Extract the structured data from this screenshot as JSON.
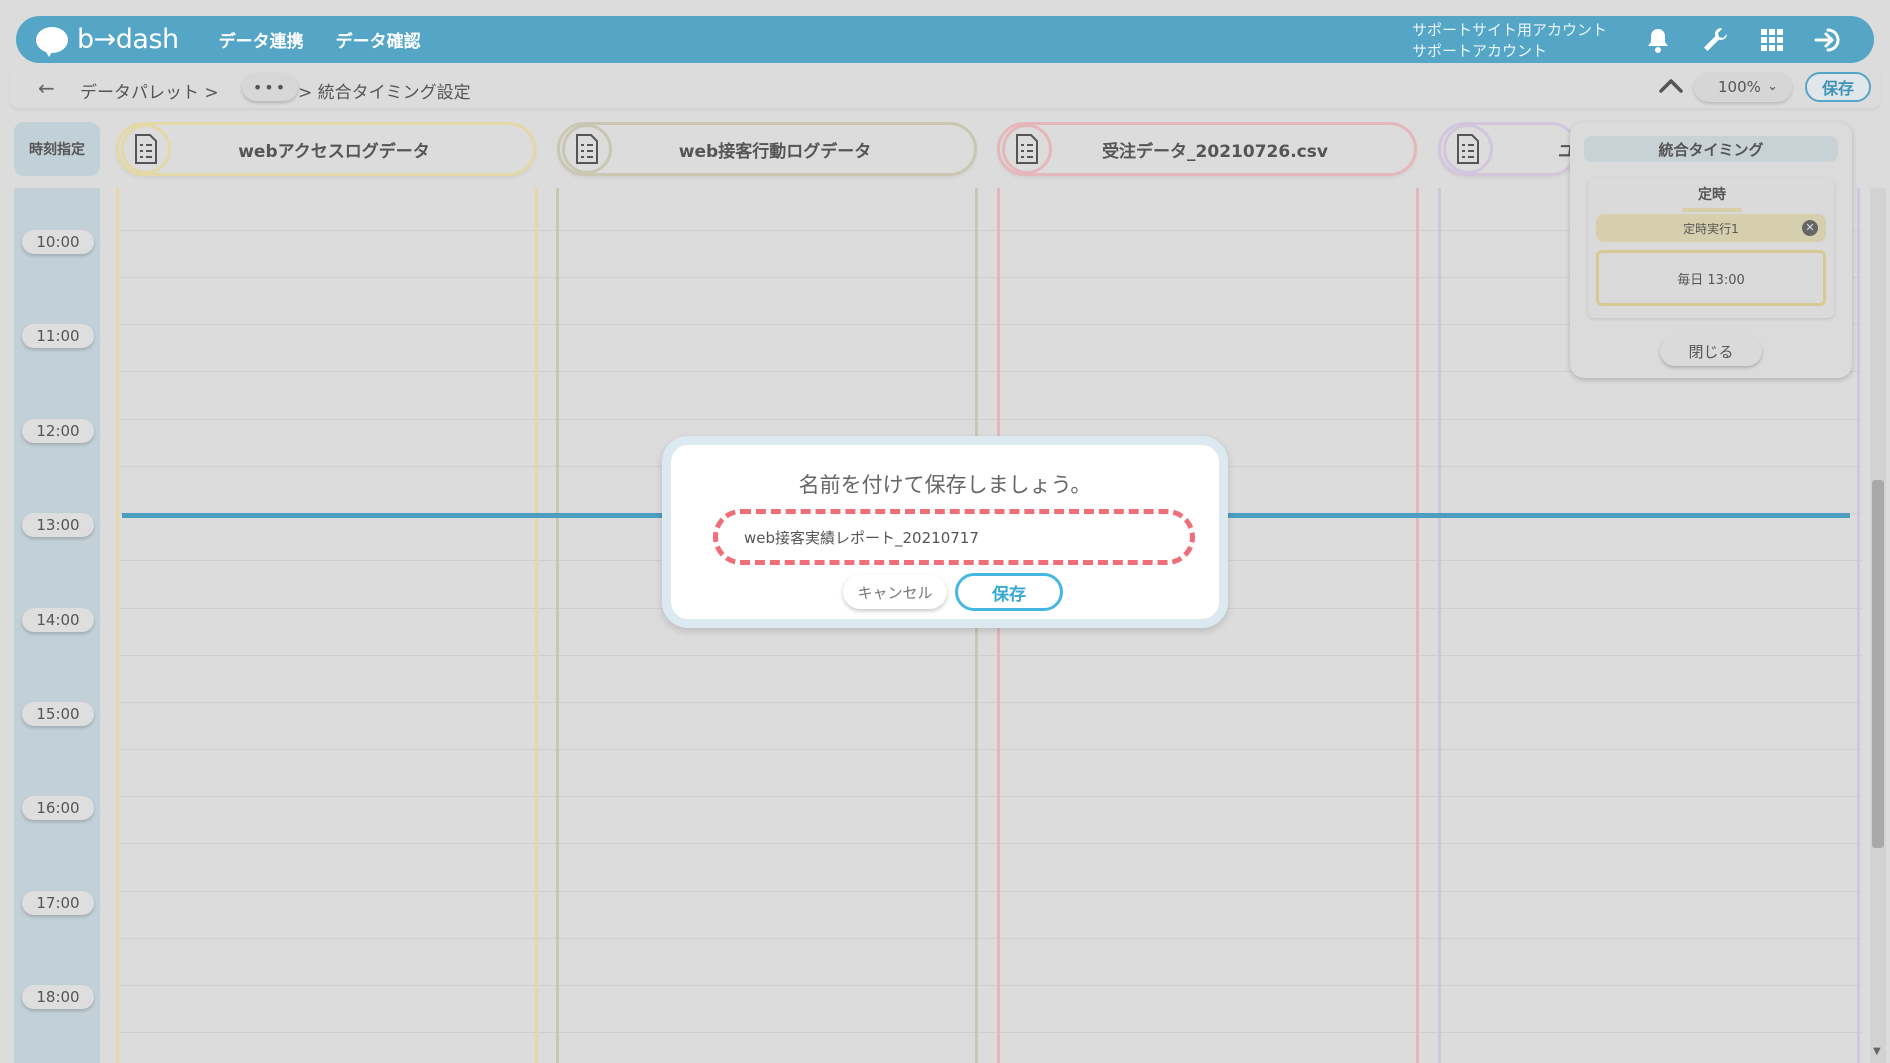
{
  "header": {
    "logo_text": "b→dash",
    "nav": [
      "データ連携",
      "データ確認"
    ],
    "account_line1": "サポートサイト用アカウント",
    "account_line2": "サポートアカウント",
    "icons": [
      "bell-icon",
      "wrench-icon",
      "apps-grid-icon",
      "logout-icon"
    ],
    "bar_color": "#55a6c6"
  },
  "toolbar": {
    "back_arrow": "←",
    "crumb_1": "データパレット >",
    "crumb_more": "•••",
    "crumb_3": "> 統合タイミング設定",
    "zoom": "100%",
    "save_label": "保存"
  },
  "timeline": {
    "time_header": "時刻指定",
    "times": [
      "10:00",
      "11:00",
      "12:00",
      "13:00",
      "14:00",
      "15:00",
      "16:00",
      "17:00",
      "18:00"
    ]
  },
  "sources": [
    {
      "label": "webアクセスログデータ",
      "color": "#e3d8a6"
    },
    {
      "label": "web接客行動ログデータ",
      "color": "#c9c7b2"
    },
    {
      "label": "受注データ_20210726.csv",
      "color": "#e4b7bc"
    },
    {
      "label": "ユ",
      "color": "#d2c6dc"
    }
  ],
  "side_panel": {
    "title": "統合タイミング",
    "tab": "定時",
    "item": "定時実行1",
    "schedule": "毎日 13:00",
    "close_label": "閉じる"
  },
  "modal": {
    "title": "名前を付けて保存しましょう。",
    "input_value": "web接客実績レポート_20210717",
    "cancel_label": "キャンセル",
    "save_label": "保存",
    "highlight_color": "#ee6e79"
  }
}
